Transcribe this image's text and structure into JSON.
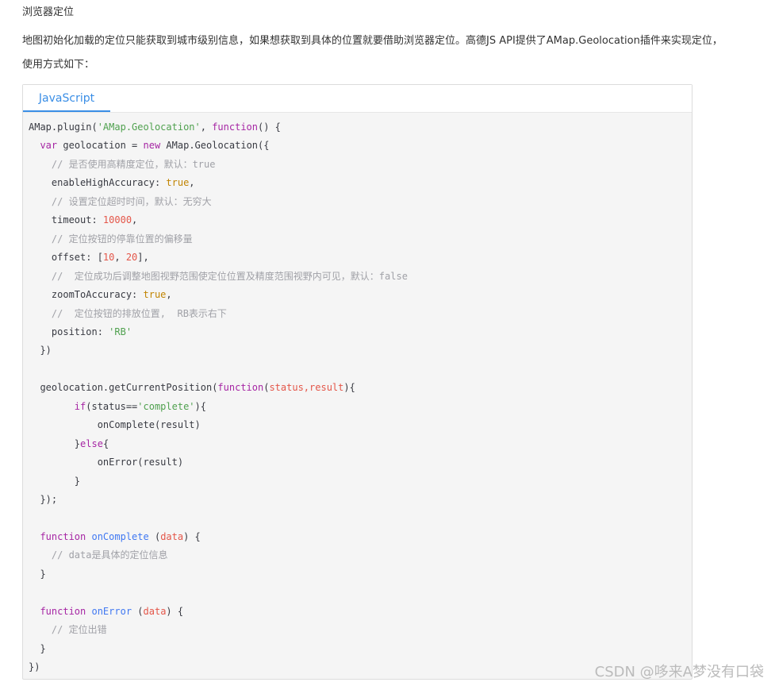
{
  "heading": "浏览器定位",
  "paragraph": {
    "line1": "地图初始化加载的定位只能获取到城市级别信息，如果想获取到具体的位置就要借助浏览器定位。高德JS API提供了AMap.Geolocation插件来实现定位，",
    "line2": "使用方式如下："
  },
  "code_block": {
    "tab_label": "JavaScript",
    "lines": [
      [
        {
          "t": "AMap.plugin(",
          "c": "p"
        },
        {
          "t": "'AMap.Geolocation'",
          "c": "str"
        },
        {
          "t": ", ",
          "c": "p"
        },
        {
          "t": "function",
          "c": "kw"
        },
        {
          "t": "() {",
          "c": "p"
        }
      ],
      [
        {
          "t": "  ",
          "c": "p"
        },
        {
          "t": "var",
          "c": "kw"
        },
        {
          "t": " geolocation = ",
          "c": "p"
        },
        {
          "t": "new",
          "c": "kw"
        },
        {
          "t": " AMap.Geolocation({",
          "c": "p"
        }
      ],
      [
        {
          "t": "    // 是否使用高精度定位，默认：true",
          "c": "cm"
        }
      ],
      [
        {
          "t": "    enableHighAccuracy: ",
          "c": "p"
        },
        {
          "t": "true",
          "c": "num"
        },
        {
          "t": ",",
          "c": "p"
        }
      ],
      [
        {
          "t": "    // 设置定位超时时间，默认：无穷大",
          "c": "cm"
        }
      ],
      [
        {
          "t": "    timeout: ",
          "c": "p"
        },
        {
          "t": "10000",
          "c": "par"
        },
        {
          "t": ",",
          "c": "p"
        }
      ],
      [
        {
          "t": "    // 定位按钮的停靠位置的偏移量",
          "c": "cm"
        }
      ],
      [
        {
          "t": "    offset: [",
          "c": "p"
        },
        {
          "t": "10",
          "c": "par"
        },
        {
          "t": ", ",
          "c": "p"
        },
        {
          "t": "20",
          "c": "par"
        },
        {
          "t": "],",
          "c": "p"
        }
      ],
      [
        {
          "t": "    //  定位成功后调整地图视野范围使定位位置及精度范围视野内可见，默认：false",
          "c": "cm"
        }
      ],
      [
        {
          "t": "    zoomToAccuracy: ",
          "c": "p"
        },
        {
          "t": "true",
          "c": "num"
        },
        {
          "t": ",",
          "c": "p"
        }
      ],
      [
        {
          "t": "    //  定位按钮的排放位置,  RB表示右下",
          "c": "cm"
        }
      ],
      [
        {
          "t": "    position: ",
          "c": "p"
        },
        {
          "t": "'RB'",
          "c": "str"
        }
      ],
      [
        {
          "t": "  })",
          "c": "p"
        }
      ],
      [
        {
          "t": "",
          "c": "p"
        }
      ],
      [
        {
          "t": "  geolocation.getCurrentPosition(",
          "c": "p"
        },
        {
          "t": "function",
          "c": "kw"
        },
        {
          "t": "(",
          "c": "p"
        },
        {
          "t": "status,result",
          "c": "par"
        },
        {
          "t": "){",
          "c": "p"
        }
      ],
      [
        {
          "t": "        ",
          "c": "p"
        },
        {
          "t": "if",
          "c": "kw"
        },
        {
          "t": "(status==",
          "c": "p"
        },
        {
          "t": "'complete'",
          "c": "str"
        },
        {
          "t": "){",
          "c": "p"
        }
      ],
      [
        {
          "t": "            onComplete(result)",
          "c": "p"
        }
      ],
      [
        {
          "t": "        }",
          "c": "p"
        },
        {
          "t": "else",
          "c": "kw"
        },
        {
          "t": "{",
          "c": "p"
        }
      ],
      [
        {
          "t": "            onError(result)",
          "c": "p"
        }
      ],
      [
        {
          "t": "        }",
          "c": "p"
        }
      ],
      [
        {
          "t": "  });",
          "c": "p"
        }
      ],
      [
        {
          "t": "",
          "c": "p"
        }
      ],
      [
        {
          "t": "  ",
          "c": "p"
        },
        {
          "t": "function",
          "c": "kw"
        },
        {
          "t": " ",
          "c": "p"
        },
        {
          "t": "onComplete",
          "c": "fn"
        },
        {
          "t": " (",
          "c": "p"
        },
        {
          "t": "data",
          "c": "par"
        },
        {
          "t": ") {",
          "c": "p"
        }
      ],
      [
        {
          "t": "    // data是具体的定位信息",
          "c": "cm"
        }
      ],
      [
        {
          "t": "  }",
          "c": "p"
        }
      ],
      [
        {
          "t": "",
          "c": "p"
        }
      ],
      [
        {
          "t": "  ",
          "c": "p"
        },
        {
          "t": "function",
          "c": "kw"
        },
        {
          "t": " ",
          "c": "p"
        },
        {
          "t": "onError",
          "c": "fn"
        },
        {
          "t": " (",
          "c": "p"
        },
        {
          "t": "data",
          "c": "par"
        },
        {
          "t": ") {",
          "c": "p"
        }
      ],
      [
        {
          "t": "    // 定位出错",
          "c": "cm"
        }
      ],
      [
        {
          "t": "  }",
          "c": "p"
        }
      ],
      [
        {
          "t": "})",
          "c": "p"
        }
      ]
    ]
  },
  "watermark": "CSDN @哆来A梦没有口袋"
}
